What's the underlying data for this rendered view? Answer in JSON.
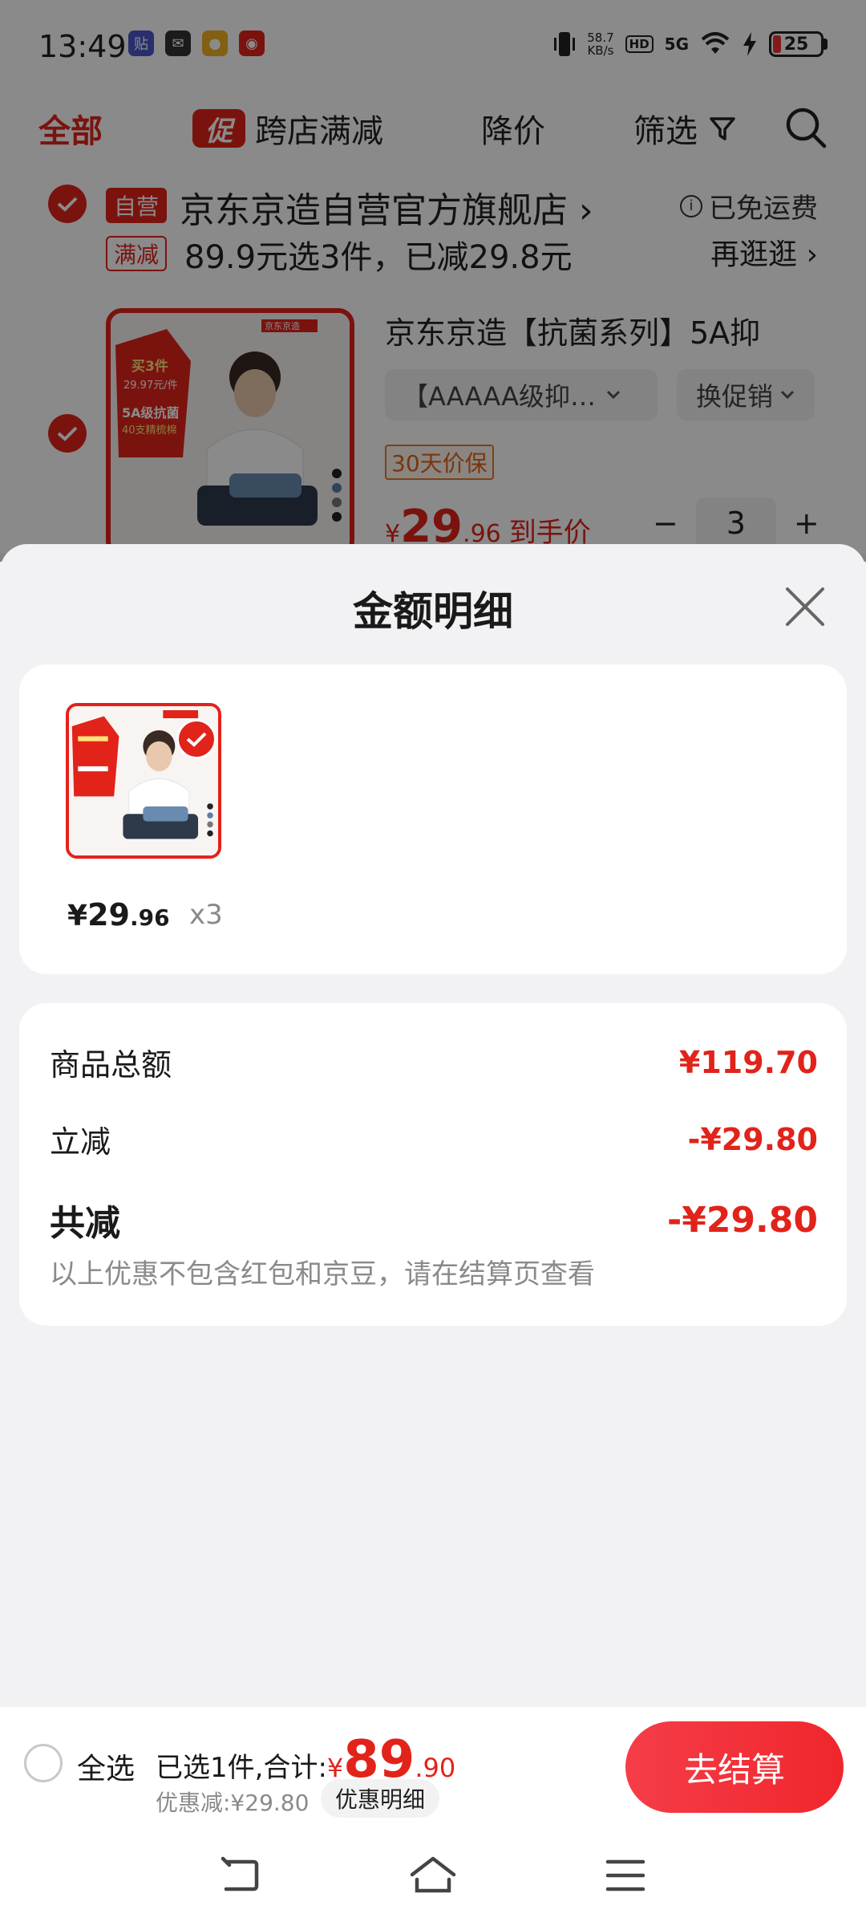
{
  "status_bar": {
    "time": "13:49",
    "net_speed_value": "58.7",
    "net_speed_unit": "KB/s",
    "hd": "HD",
    "network": "5G",
    "battery": "25"
  },
  "filter_bar": {
    "all": "全部",
    "promo_icon": "促",
    "cross_store": "跨店满减",
    "price_drop": "降价",
    "filter": "筛选"
  },
  "store": {
    "self_tag": "自营",
    "name": "京东京造自营官方旗舰店",
    "free_shipping": "已免运费",
    "full_cut_tag": "满减",
    "full_cut_text": "89.9元选3件，已减29.8元",
    "browse_more": "再逛逛"
  },
  "cart_item": {
    "title": "京东京造【抗菌系列】5A抑",
    "spec": "【AAAAA级抑…",
    "change_promo": "换促销",
    "guarantee": "30天价保",
    "price_symbol": "¥",
    "price_int": "29",
    "price_dec": ".96",
    "price_label": "到手价",
    "minus": "−",
    "qty": "3",
    "plus": "+",
    "img_text_1": "买3件",
    "img_text_2": "29.97元/件",
    "img_text_3": "5A级抗菌",
    "img_text_4": "40支精梳棉",
    "img_brand": "京东京造"
  },
  "sheet": {
    "title": "金额明细",
    "item_price_symbol": "¥",
    "item_price_int": "29",
    "item_price_dec": ".96",
    "item_qty": "x3",
    "rows": [
      {
        "label": "商品总额",
        "value": "¥119.70"
      },
      {
        "label": "立减",
        "value": "-¥29.80"
      }
    ],
    "total_label": "共减",
    "total_value": "-¥29.80",
    "note": "以上优惠不包含红包和京豆，请在结算页查看"
  },
  "bottom_bar": {
    "select_all": "全选",
    "selected_label": "已选1件,合计:",
    "total_symbol": "¥",
    "total_int": "89",
    "total_dec": ".90",
    "discount": "优惠减:¥29.80",
    "detail_button": "优惠明细",
    "checkout": "去结算"
  },
  "colors": {
    "brand_red": "#e2231a",
    "sheet_bg": "#f2f2f4",
    "muted_text": "#8a8a8a"
  }
}
